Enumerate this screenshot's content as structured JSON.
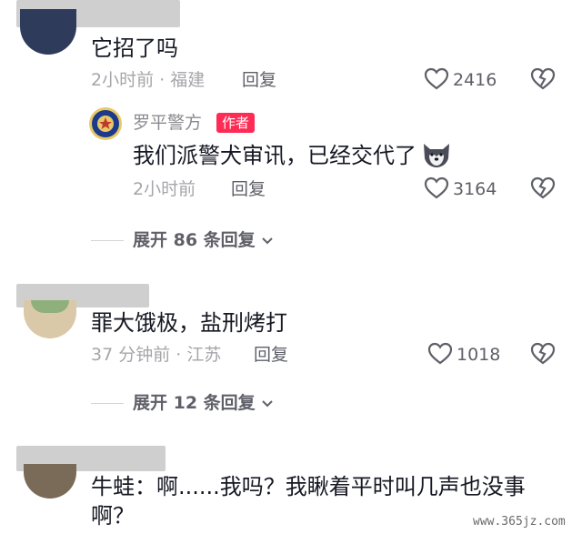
{
  "comments": [
    {
      "text": "它招了吗",
      "time_location": "2小时前 · 福建",
      "reply_label": "回复",
      "likes": "2416"
    },
    {
      "text": "罪大饿极，盐刑烤打",
      "time_location": "37 分钟前 · 江苏",
      "reply_label": "回复",
      "likes": "1018",
      "expand_label": "展开 12 条回复"
    },
    {
      "text_line1": "牛蛙：啊......我吗？我瞅着平时叫几声也没事",
      "text_line2": "啊？"
    }
  ],
  "author_reply": {
    "name": "罗平警方",
    "badge": "作者",
    "text": "我们派警犬审讯，已经交代了",
    "time": "2小时前",
    "reply_label": "回复",
    "likes": "3164"
  },
  "thread1_expand_label": "展开 86 条回复",
  "watermark": "www.365jz.com",
  "icons": {
    "like": "heart-outline-icon",
    "dislike": "broken-heart-icon",
    "expand": "chevron-down-icon",
    "emoji": "husky-dog-emoji-icon"
  },
  "colors": {
    "author_badge": "#fe2c55",
    "text": "#161823",
    "meta": "#a6a6ab"
  }
}
